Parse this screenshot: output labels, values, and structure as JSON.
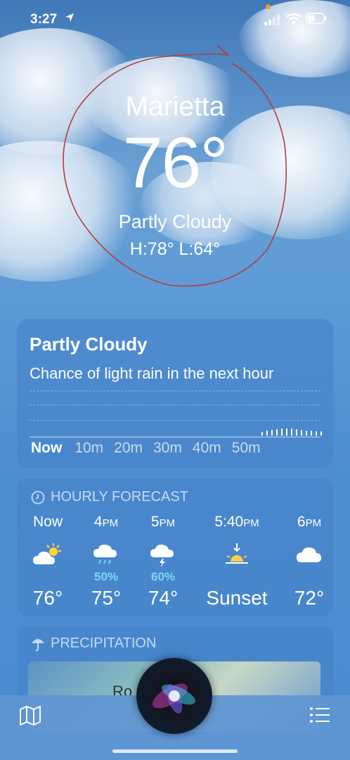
{
  "status": {
    "time": "3:27"
  },
  "header": {
    "city": "Marietta",
    "temperature": "76°",
    "condition": "Partly Cloudy",
    "hilo": "H:78°  L:64°"
  },
  "summary": {
    "title": "Partly Cloudy",
    "subtitle": "Chance of light rain in the next hour",
    "timeline": [
      "Now",
      "10m",
      "20m",
      "30m",
      "40m",
      "50m"
    ]
  },
  "hourly": {
    "header": "HOURLY FORECAST",
    "items": [
      {
        "time": "Now",
        "suffix": "",
        "pct": "",
        "temp": "76°",
        "icon": "partly-cloudy-icon"
      },
      {
        "time": "4",
        "suffix": "PM",
        "pct": "50%",
        "temp": "75°",
        "icon": "rain-cloud-icon"
      },
      {
        "time": "5",
        "suffix": "PM",
        "pct": "60%",
        "temp": "74°",
        "icon": "thunderstorm-icon"
      },
      {
        "time": "5:40",
        "suffix": "PM",
        "pct": "",
        "temp": "Sunset",
        "icon": "sunset-icon"
      },
      {
        "time": "6",
        "suffix": "PM",
        "pct": "",
        "temp": "72°",
        "icon": "cloud-icon"
      }
    ]
  },
  "precipitation": {
    "header": "PRECIPITATION",
    "map_label": "Ro"
  },
  "colors": {
    "accent_rain": "#7ad7f5",
    "annotation": "#b0413e"
  }
}
